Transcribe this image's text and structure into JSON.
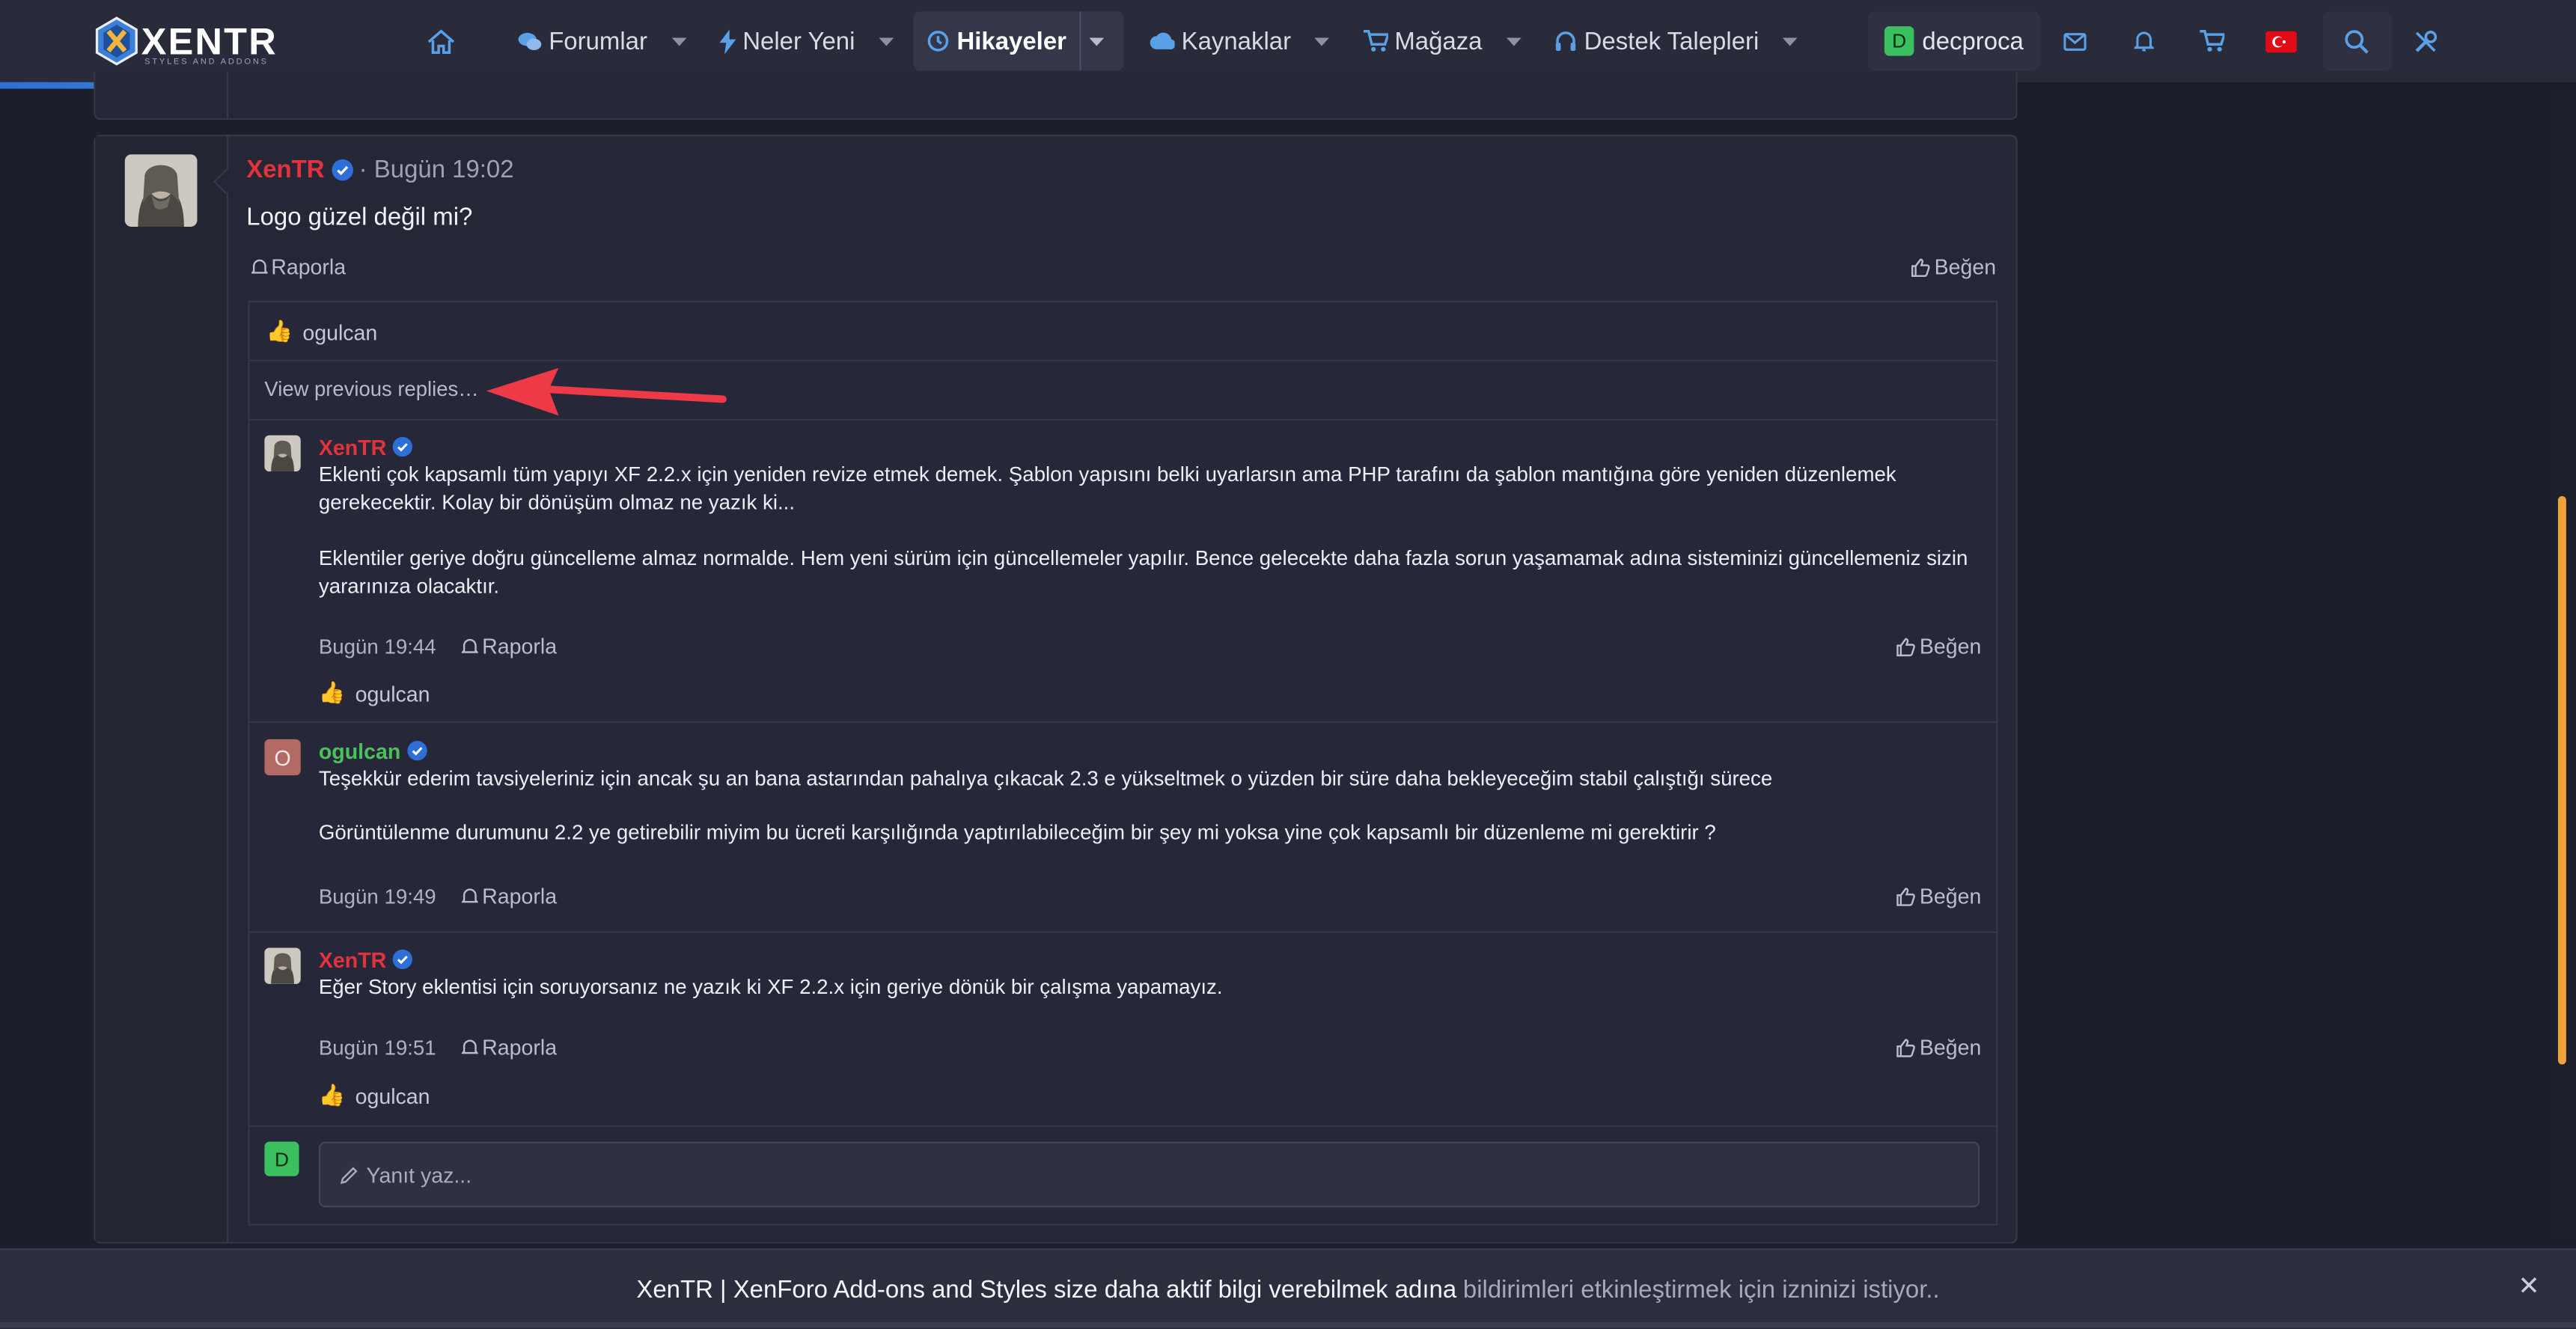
{
  "brand": {
    "name": "XENTR",
    "tagline": "STYLES AND ADDONS"
  },
  "nav": {
    "items": [
      {
        "label": "Forumlar",
        "icon": "chat-bubbles-icon"
      },
      {
        "label": "Neler Yeni",
        "icon": "lightning-icon"
      },
      {
        "label": "Hikayeler",
        "icon": "history-icon"
      },
      {
        "label": "Kaynaklar",
        "icon": "cloud-download-icon"
      },
      {
        "label": "Mağaza",
        "icon": "cart-icon"
      },
      {
        "label": "Destek Talepleri",
        "icon": "headset-icon"
      }
    ]
  },
  "user": {
    "initial": "D",
    "name": "decproca"
  },
  "message": {
    "author": "XenTR",
    "time": "· Bugün 19:02",
    "body": "Logo güzel değil mi?",
    "report_label": "Raporla",
    "like_label": "Beğen",
    "reaction_user": "ogulcan",
    "view_previous": "View previous replies…"
  },
  "replies": [
    {
      "author": "XenTR",
      "paragraphs": [
        "Eklenti çok kapsamlı tüm yapıyı XF 2.2.x için yeniden revize etmek demek. Şablon yapısını belki uyarlarsın ama PHP tarafını da şablon mantığına göre yeniden düzenlemek gerekecektir. Kolay bir dönüşüm olmaz ne yazık ki...",
        "Eklentiler geriye doğru güncelleme almaz normalde. Hem yeni sürüm için güncellemeler yapılır. Bence gelecekte daha fazla sorun yaşamamak adına sisteminizi güncellemeniz sizin yararınıza olacaktır."
      ],
      "time": "Bugün 19:44",
      "report": "Raporla",
      "like": "Beğen",
      "reaction": "ogulcan"
    },
    {
      "author": "ogulcan",
      "avatar_initial": "O",
      "paragraphs": [
        "Teşekkür ederim tavsiyeleriniz için ancak şu an bana astarından pahalıya çıkacak 2.3 e yükseltmek o yüzden bir süre daha bekleyeceğim stabil çalıştığı sürece",
        "Görüntülenme durumunu 2.2 ye getirebilir miyim bu ücreti karşılığında yaptırılabileceğim bir şey mi yoksa yine çok kapsamlı bir düzenleme mi gerektirir ?"
      ],
      "time": "Bugün 19:49",
      "report": "Raporla",
      "like": "Beğen"
    },
    {
      "author": "XenTR",
      "paragraphs": [
        "Eğer Story eklentisi için soruyorsanız ne yazık ki XF 2.2.x için geriye dönük bir çalışma yapamayız."
      ],
      "time": "Bugün 19:51",
      "report": "Raporla",
      "like": "Beğen",
      "reaction": "ogulcan"
    }
  ],
  "compose": {
    "avatar_initial": "D",
    "placeholder": "Yanıt yaz..."
  },
  "notice": {
    "main": "XenTR | XenForo Add-ons and Styles size daha aktif bilgi verebilmek adına",
    "link": "bildirimleri etkinleştirmek için izninizi istiyor..",
    "close": "✕"
  },
  "colors": {
    "accent_red": "#e2333c",
    "accent_green": "#4cc05a",
    "link_blue": "#5aa0e6",
    "annotation_red": "#ee3a46"
  }
}
